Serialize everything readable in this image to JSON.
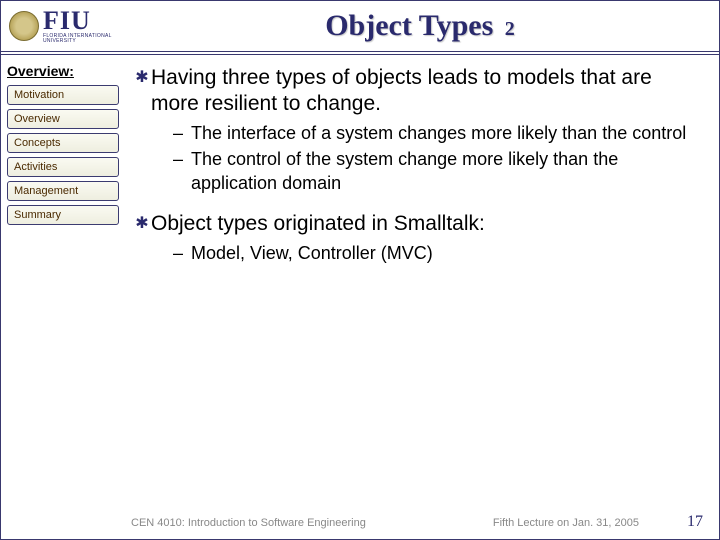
{
  "header": {
    "logo_main": "FIU",
    "logo_sub": "FLORIDA INTERNATIONAL UNIVERSITY",
    "title_main": "Object Types",
    "title_sub": "2"
  },
  "sidebar": {
    "heading": "Overview:",
    "items": [
      {
        "label": "Motivation"
      },
      {
        "label": "Overview"
      },
      {
        "label": "Concepts"
      },
      {
        "label": "Activities"
      },
      {
        "label": "Management"
      },
      {
        "label": "Summary"
      }
    ]
  },
  "content": {
    "bullets": [
      {
        "text": "Having three types of objects leads to models that are more resilient to change.",
        "subs": [
          "The interface of a system changes more likely than the control",
          "The control of the system change more likely than the application domain"
        ]
      },
      {
        "text": "Object types originated in Smalltalk:",
        "subs": [
          "Model, View, Controller (MVC)"
        ]
      }
    ]
  },
  "footer": {
    "left": "CEN 4010: Introduction to Software Engineering",
    "mid": "Fifth Lecture on Jan. 31, 2005",
    "page": "17"
  }
}
